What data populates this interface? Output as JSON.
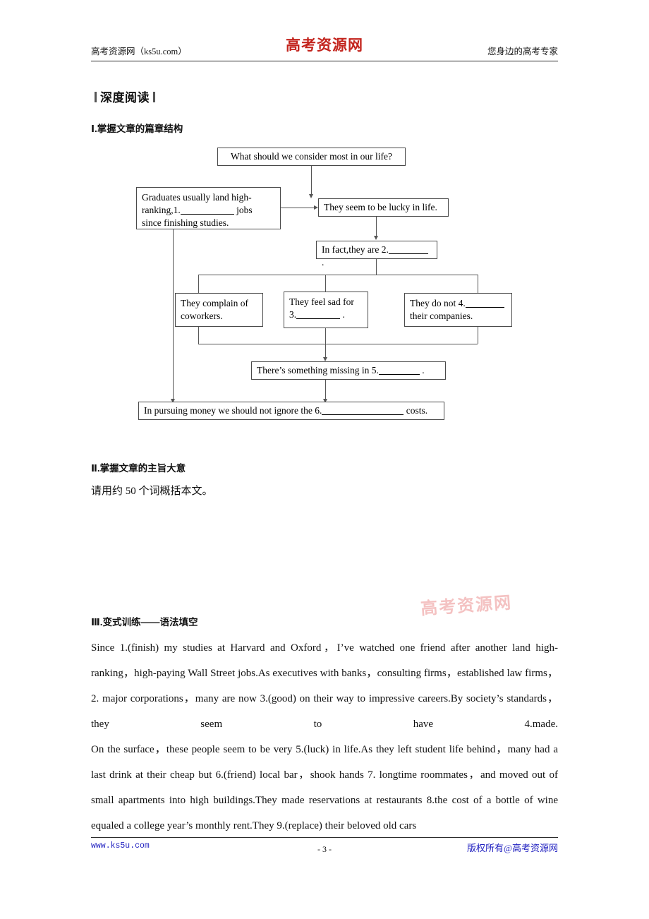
{
  "header": {
    "left_label": "高考资源网（ks5u.com）",
    "logo_text": "高考资源网",
    "right_label": "您身边的高考专家"
  },
  "section_title": "深度阅读",
  "sections": {
    "one_heading": "Ⅰ.掌握文章的篇章结构",
    "two_heading": "Ⅱ.掌握文章的主旨大意",
    "two_body": "请用约 50 个词概括本文。",
    "three_heading": "Ⅲ.变式训练——语法填空"
  },
  "flowchart": {
    "box_top": "What should we consider most in our life?",
    "box_left": {
      "line1": "Graduates usually land high-",
      "line2_prefix": "ranking,1.",
      "line2_suffix": "jobs",
      "line3": "since finishing studies."
    },
    "box_lucky": "They seem to be lucky in life.",
    "box_infact_prefix": "In fact,they are 2.",
    "box_infact_suffix": ".",
    "box_complain": {
      "line1": "They complain of",
      "line2": "coworkers."
    },
    "box_sad": {
      "line1": "They feel sad for",
      "line2_prefix": "3.",
      "line2_suffix": "."
    },
    "box_companies": {
      "line1_prefix": "They do not 4.",
      "line2": "their companies."
    },
    "box_missing_prefix": "There’s something missing in 5.",
    "box_missing_suffix": ".",
    "box_bottom_prefix": "In pursuing money we should not ignore the 6.",
    "box_bottom_suffix": "costs."
  },
  "watermark": "高考资源网",
  "paragraphs": [
    "Since 1.(finish) my studies at Harvard and Oxford，I’ve watched one friend after another land high-ranking，high-paying Wall Street jobs.As executives with banks，consulting firms，established law firms，2. major corporations，many are now 3.(good) on their way to impressive careers.By society’s standards，they seem to have 4.made.",
    "On the surface，these people seem to be very 5.(luck) in life.As they left student life behind，many had a last drink at their cheap but 6.(friend) local bar，shook hands 7. longtime roommates，and moved out of small apartments into high buildings.They made reservations at restaurants 8.the cost of a bottle of wine equaled a college year’s monthly rent.They 9.(replace) their beloved old cars"
  ],
  "footer": {
    "left": "www.ks5u.com",
    "page": "- 3 -",
    "right": "版权所有@高考资源网"
  }
}
